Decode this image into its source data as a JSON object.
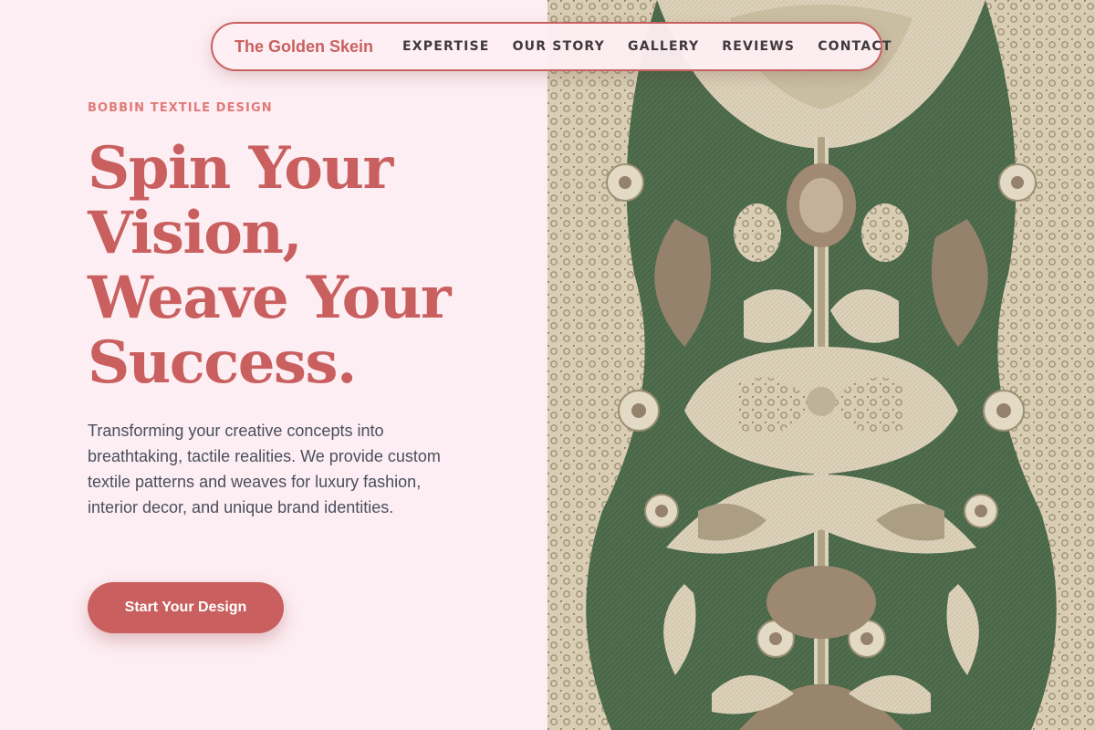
{
  "nav": {
    "brand": "The Golden Skein",
    "links": [
      "EXPERTISE",
      "OUR STORY",
      "GALLERY",
      "REVIEWS",
      "CONTACT"
    ]
  },
  "hero": {
    "eyebrow": "BOBBIN TEXTILE DESIGN",
    "headline_lines": [
      "Spin Your",
      "Vision,",
      "Weave Your",
      "Success."
    ],
    "description": "Transforming your creative concepts into breathtaking, tactile realities. We provide custom textile patterns and weaves for luxury fashion, interior decor, and unique brand identities.",
    "cta_label": "Start Your Design"
  },
  "colors": {
    "accent": "#c9605f",
    "eyebrow": "#e07b78",
    "background": "#fdeef3",
    "body_text": "#4a4f5c",
    "fabric_green": "#4f6b4e",
    "fabric_cream": "#e9dcc4"
  },
  "image": {
    "icon": "brocade-textile-image"
  }
}
